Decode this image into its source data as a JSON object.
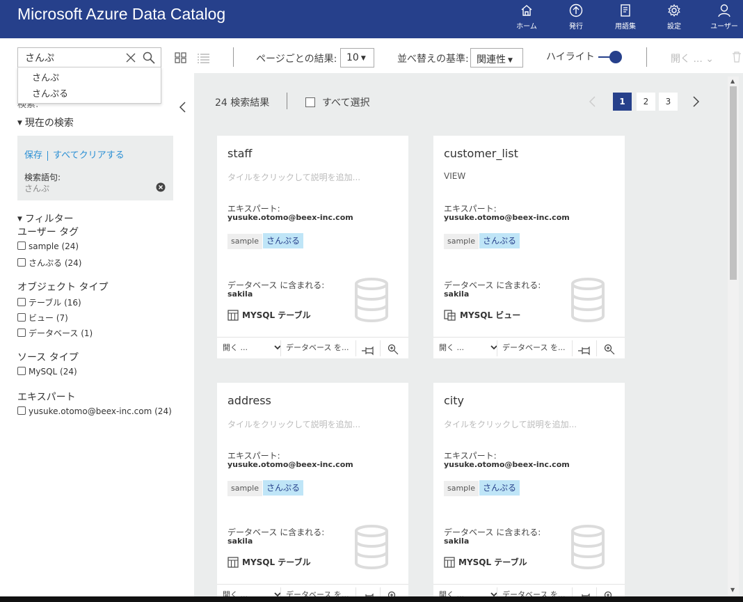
{
  "app": {
    "title": "Microsoft Azure Data Catalog"
  },
  "nav": [
    {
      "label": "ホーム",
      "icon": "home-icon"
    },
    {
      "label": "発行",
      "icon": "publish-icon"
    },
    {
      "label": "用語集",
      "icon": "glossary-icon"
    },
    {
      "label": "設定",
      "icon": "gear-icon"
    },
    {
      "label": "ユーザー",
      "icon": "user-icon"
    }
  ],
  "search": {
    "value": "さんぷ",
    "suggestions": [
      "さんぷ",
      "さんぷる"
    ]
  },
  "toolbar": {
    "per_page_label": "ページごとの結果:",
    "per_page_value": "10",
    "sort_label": "並べ替えの基準:",
    "sort_value": "関連性",
    "highlight_label": "ハイライト",
    "open_label": "開く ...",
    "open_chevron": "⌄"
  },
  "left": {
    "hidden_label": "検索:",
    "current_search_title": "現在の検索",
    "save_label": "保存",
    "clear_all_label": "すべてクリアする",
    "term_label": "検索語句:",
    "term_value": "さんぷ",
    "filter_title": "フィルター",
    "groups": [
      {
        "title": "ユーザー タグ",
        "options": [
          {
            "label": "sample",
            "count": "(24)"
          },
          {
            "label": "さんぷる",
            "count": "(24)"
          }
        ]
      },
      {
        "title": "オブジェクト タイプ",
        "options": [
          {
            "label": "テーブル",
            "count": "(16)"
          },
          {
            "label": "ビュー",
            "count": "(7)"
          },
          {
            "label": "データベース",
            "count": "(1)"
          }
        ]
      },
      {
        "title": "ソース タイプ",
        "options": [
          {
            "label": "MySQL",
            "count": "(24)"
          }
        ]
      },
      {
        "title": "エキスパート",
        "options": [
          {
            "label": "yusuke.otomo@beex-inc.com",
            "count": "(24)"
          }
        ]
      }
    ]
  },
  "results": {
    "count_label": "24 検索結果",
    "select_all_label": "すべて選択",
    "pages": [
      "1",
      "2",
      "3"
    ],
    "active_page": "1"
  },
  "cards": [
    {
      "title": "staff",
      "desc": "タイルをクリックして説明を追加...",
      "desc_is_type": false,
      "expert_label": "エキスパート:",
      "expert": "yusuke.otomo@beex-inc.com",
      "tags": [
        "sample",
        "さんぷる"
      ],
      "db_label": "データベース に含まれる:",
      "db": "sakila",
      "object_type": "MYSQL テーブル",
      "object_kind": "table",
      "open": "開く ...",
      "database": "データベース を..."
    },
    {
      "title": "customer_list",
      "desc": "VIEW",
      "desc_is_type": true,
      "expert_label": "エキスパート:",
      "expert": "yusuke.otomo@beex-inc.com",
      "tags": [
        "sample",
        "さんぷる"
      ],
      "db_label": "データベース に含まれる:",
      "db": "sakila",
      "object_type": "MYSQL ビュー",
      "object_kind": "view",
      "open": "開く ...",
      "database": "データベース を..."
    },
    {
      "title": "address",
      "desc": "タイルをクリックして説明を追加...",
      "desc_is_type": false,
      "expert_label": "エキスパート:",
      "expert": "yusuke.otomo@beex-inc.com",
      "tags": [
        "sample",
        "さんぷる"
      ],
      "db_label": "データベース に含まれる:",
      "db": "sakila",
      "object_type": "MYSQL テーブル",
      "object_kind": "table",
      "open": "開く ...",
      "database": "データベース を..."
    },
    {
      "title": "city",
      "desc": "タイルをクリックして説明を追加...",
      "desc_is_type": false,
      "expert_label": "エキスパート:",
      "expert": "yusuke.otomo@beex-inc.com",
      "tags": [
        "sample",
        "さんぷる"
      ],
      "db_label": "データベース に含まれる:",
      "db": "sakila",
      "object_type": "MYSQL テーブル",
      "object_kind": "table",
      "open": "開く ...",
      "database": "データベース を..."
    }
  ],
  "colors": {
    "brand": "#26408b",
    "tag_blue": "#bfe5f7",
    "link": "#2a8fd4",
    "panel_bg": "#ebeded"
  }
}
